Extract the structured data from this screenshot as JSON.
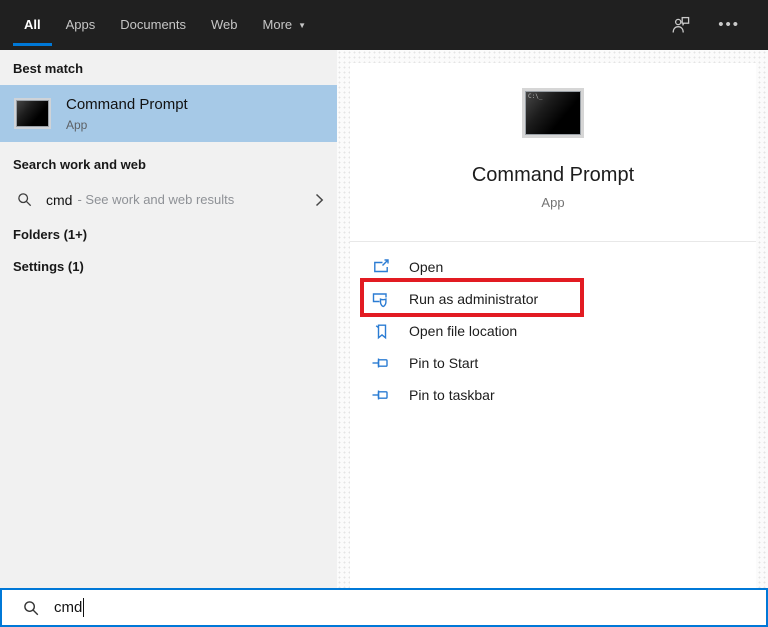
{
  "topbar": {
    "tabs": [
      {
        "label": "All",
        "active": true
      },
      {
        "label": "Apps",
        "active": false
      },
      {
        "label": "Documents",
        "active": false
      },
      {
        "label": "Web",
        "active": false
      },
      {
        "label": "More",
        "active": false,
        "dropdown_arrow": "▼"
      }
    ],
    "icons": [
      "feedback-person-icon",
      "ellipsis-icon"
    ]
  },
  "left_panel": {
    "best_match_header": "Best match",
    "best_match": {
      "title": "Command Prompt",
      "subtitle": "App",
      "icon": "command-prompt-icon"
    },
    "search_header": "Search work and web",
    "web_suggestion": {
      "query": "cmd",
      "hint": "- See work and web results",
      "icon": "search-icon",
      "chevron": "chevron-right-icon"
    },
    "folders_header": "Folders (1+)",
    "settings_header": "Settings (1)"
  },
  "preview_panel": {
    "icon": "command-prompt-icon",
    "icon_text": "C:\\_",
    "title": "Command Prompt",
    "subtitle": "App",
    "actions": [
      {
        "label": "Open",
        "icon": "open-icon",
        "highlighted": false
      },
      {
        "label": "Run as administrator",
        "icon": "run-as-admin-icon",
        "highlighted": true
      },
      {
        "label": "Open file location",
        "icon": "open-file-location-icon",
        "highlighted": false
      },
      {
        "label": "Pin to Start",
        "icon": "pin-icon",
        "highlighted": false
      },
      {
        "label": "Pin to taskbar",
        "icon": "pin-icon",
        "highlighted": false
      }
    ],
    "annotation": "red-highlight-rectangle"
  },
  "search_bar": {
    "value": "cmd",
    "icon": "search-icon"
  },
  "colors": {
    "accent": "#0078d7",
    "topbar_bg": "#202020",
    "left_panel_bg": "#f1f1f1",
    "highlight_blue": "#a6c9e7",
    "icon_blue": "#2b7cd3",
    "annotation_red": "#e21b22"
  }
}
